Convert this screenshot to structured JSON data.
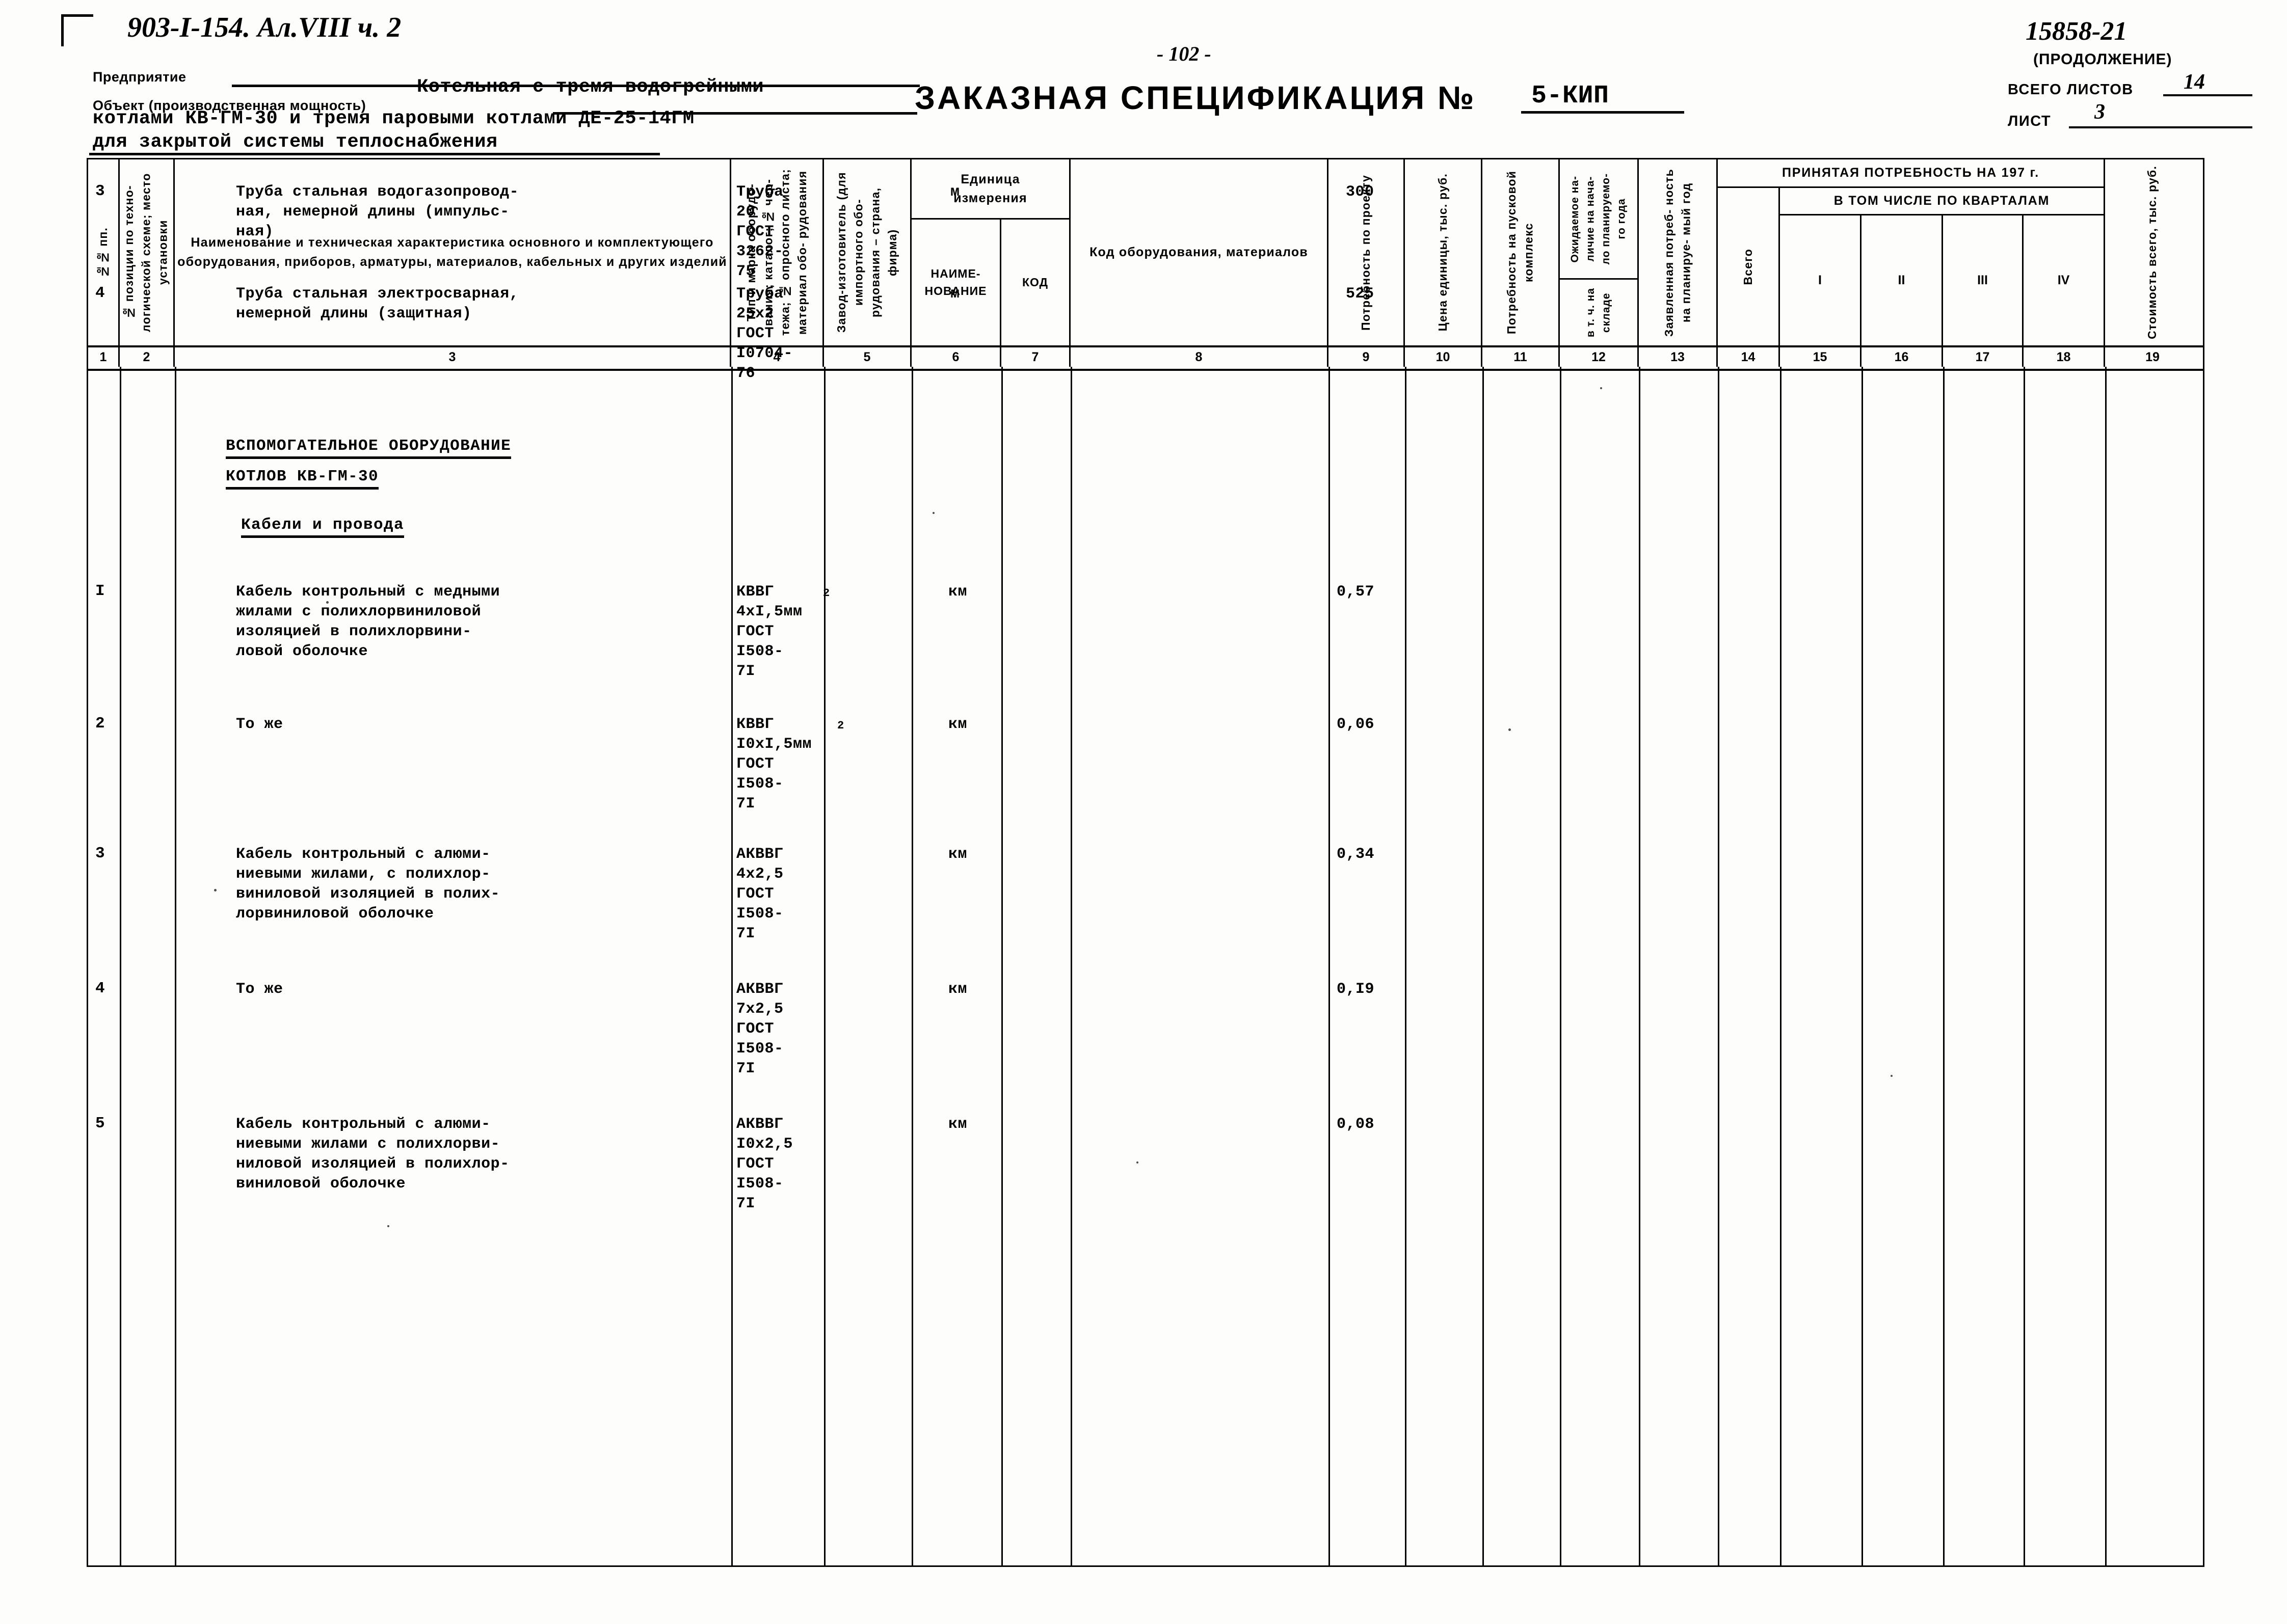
{
  "document": {
    "doc_code": "903-I-154. Ал.VIII ч. 2",
    "page_number": "- 102 -",
    "sheet_code": "15858-21",
    "continuation": "(ПРОДОЛЖЕНИЕ)",
    "title": "ЗАКАЗНАЯ СПЕЦИФИКАЦИЯ №",
    "title_value": "5-КИП",
    "total_sheets_label": "ВСЕГО ЛИСТОВ",
    "total_sheets_value": "14",
    "sheet_label": "ЛИСТ",
    "sheet_value": "3"
  },
  "form": {
    "enterprise_label": "Предприятие",
    "enterprise_value": "",
    "object_label": "Объект (производственная мощность)",
    "object_line1": "Котельная с тремя водогрейными",
    "object_line2": "котлами КВ-ГМ-30 и тремя паровыми котлами ДЕ-25-14ГМ",
    "object_line3": "для закрытой системы теплоснабжения"
  },
  "table": {
    "columns": [
      {
        "no": "1",
        "title": "№№ пп."
      },
      {
        "no": "2",
        "title": "№ позиции по техно-\nлогической схеме;\nместо установки"
      },
      {
        "no": "3",
        "title": "Наименование и техническая  характеристика\nосновного и комплектующего оборудования,\nприборов, арматуры, материалов, кабельных\nи других изделий"
      },
      {
        "no": "4",
        "title": "Тип и марка оборудо-\nвания; каталог; № чер-\nтежа; № опросного\nлиста; материал обо-\nрудования"
      },
      {
        "no": "5",
        "title": "Завод-изготовитель\n(для импортного обо-\nрудования – страна,\nфирма)"
      },
      {
        "no": "6",
        "title": "НАИМЕ-\nНОВАНИЕ"
      },
      {
        "no": "7",
        "title": "КОД"
      },
      {
        "no": "8",
        "title": "Код  оборудования,\nматериалов"
      },
      {
        "no": "9",
        "title": "Потребность\nпо проекту"
      },
      {
        "no": "10",
        "title": "Цена единицы,\nтыс. руб."
      },
      {
        "no": "11",
        "title": "Потребность на\nпусковой комплекс"
      },
      {
        "no": "12",
        "title": "Ожидаемое на-\nличие на нача-\nло планируемо-\nго года"
      },
      {
        "no": "12b",
        "title": "в т. ч. на\nскладе"
      },
      {
        "no": "13",
        "title": "Заявленная потреб-\nность на планируе-\nмый год"
      },
      {
        "no": "14",
        "title": "Всего"
      },
      {
        "no": "15",
        "title": "I"
      },
      {
        "no": "16",
        "title": "II"
      },
      {
        "no": "17",
        "title": "III"
      },
      {
        "no": "18",
        "title": "IV"
      },
      {
        "no": "19",
        "title": "Стоимость всего,\nтыс. руб."
      }
    ],
    "group_unit": "Единица\nизмерения",
    "group_demand": "ПРИНЯТАЯ  ПОТРЕБНОСТЬ  НА  197        г.",
    "group_quarters": "В ТОМ ЧИСЛЕ  ПО КВАРТАЛАМ"
  },
  "rows": [
    {
      "no": "3",
      "name": "Труба стальная водогазопровод-\nная, немерной длины (импульс-\nная)",
      "type": "Труба\n20\nГОСТ\n3262-\n75",
      "unit": "м",
      "qty": "300"
    },
    {
      "no": "4",
      "name": "Труба стальная электросварная,\nнемерной длины (защитная)",
      "type": "Труба\n25х2\nГОСТ\nI0704-\n76",
      "unit": "м",
      "qty": "525"
    },
    {
      "no": "I",
      "name": "Кабель контрольный с медными\nжилами с полихлорвиниловой\nизоляцией в полихлорвини-\nловой оболочке",
      "type": "КВВГ\n4хI,5мм\nГОСТ\nI508-\n7I",
      "type_sup": "2",
      "unit": "км",
      "qty": "0,57"
    },
    {
      "no": "2",
      "name": "То же",
      "type": "КВВГ\nI0хI,5мм\nГОСТ\nI508-\n7I",
      "type_sup": "2",
      "unit": "км",
      "qty": "0,06"
    },
    {
      "no": "3",
      "name": "Кабель контрольный с алюми-\nниевыми жилами, с полихлор-\nвиниловой изоляцией в полих-\nлорвиниловой оболочке",
      "type": "АКВВГ\n4х2,5\nГОСТ\nI508-\n7I",
      "unit": "км",
      "qty": "0,34"
    },
    {
      "no": "4",
      "name": "То же",
      "type": "АКВВГ\n7х2,5\nГОСТ\nI508-\n7I",
      "unit": "км",
      "qty": "0,I9"
    },
    {
      "no": "5",
      "name": "Кабель контрольный с алюми-\nниевыми жилами с полихлорви-\nниловой изоляцией в полихлор-\nвиниловой оболочке",
      "type": "АКВВГ\nI0х2,5\nГОСТ\nI508-\n7I",
      "unit": "км",
      "qty": "0,08"
    }
  ],
  "sections": [
    {
      "line1": "ВСПОМОГАТЕЛЬНОЕ ОБОРУДОВАНИЕ",
      "line2": "КОТЛОВ КВ-ГМ-30"
    },
    {
      "line1": "Кабели и провода"
    }
  ]
}
